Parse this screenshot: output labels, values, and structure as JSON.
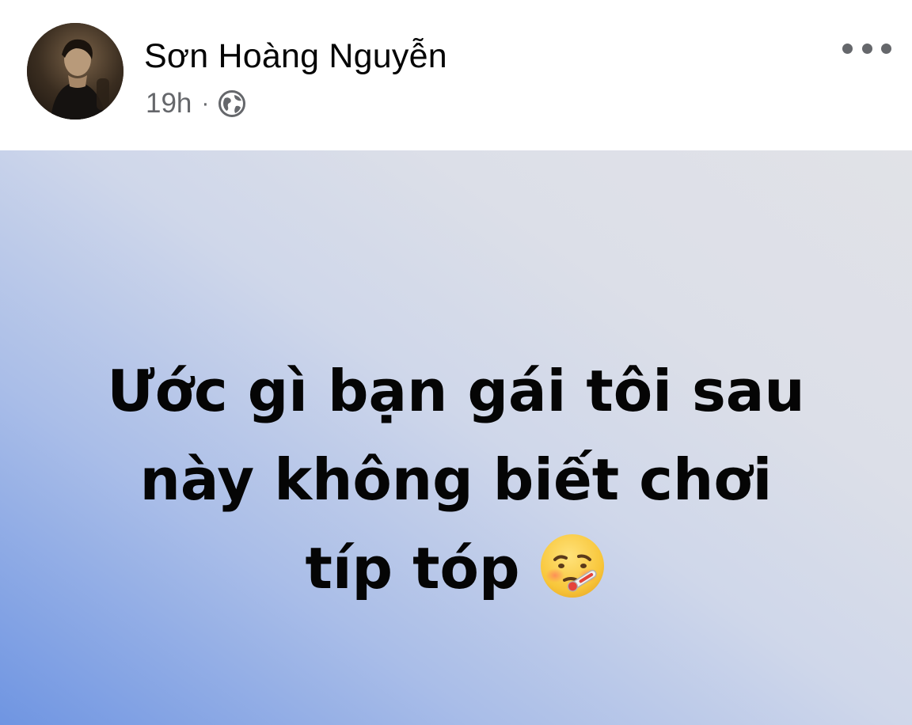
{
  "post": {
    "author": "Sơn Hoàng Nguyễn",
    "time": "19h",
    "separator": "·",
    "audience_icon": "globe-icon",
    "menu_icon": "more-options-icon",
    "text_lines": [
      "Ước gì bạn gái tôi sau",
      "này không biết chơi",
      "típ tóp"
    ],
    "emoji_icon": "face-with-thermometer-icon"
  },
  "colors": {
    "name_text": "#050505",
    "meta_text": "#65676b",
    "background_gradient_start": "#6f95e2",
    "background_gradient_end": "#e1e2e7"
  }
}
